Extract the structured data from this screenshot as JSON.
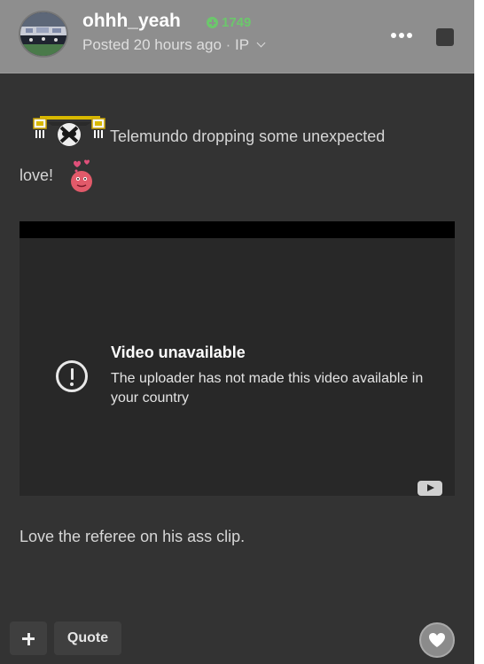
{
  "post": {
    "author": {
      "username": "ohhh_yeah",
      "reputation": "1749",
      "posted_label": "Posted 20 hours ago",
      "separator": "·",
      "ip_label": "IP"
    },
    "content": {
      "line1": "Telemundo dropping some unexpected",
      "line2": "love!",
      "closing_text": "Love the referee on his ass clip."
    },
    "video": {
      "title": "Video unavailable",
      "message": "The uploader has not made this video available in your country"
    },
    "actions": {
      "quote_label": "Quote"
    }
  },
  "icons": {
    "reputation": "plus-circle-icon",
    "more": "ellipsis-icon",
    "alert": "exclamation-circle-icon",
    "youtube": "youtube-icon",
    "like": "heart-icon",
    "add": "plus-icon"
  },
  "colors": {
    "header_bg": "#8e8e8e",
    "post_bg": "#333333",
    "reputation_green": "#6cc76c",
    "video_bg": "#282828"
  }
}
